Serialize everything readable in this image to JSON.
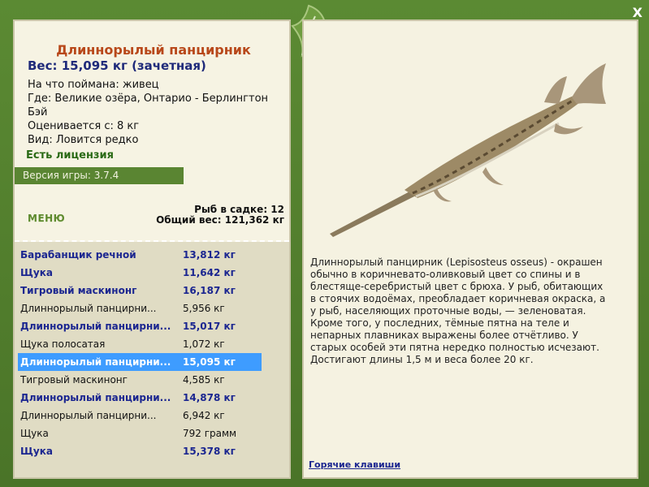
{
  "window": {
    "close_glyph": "X"
  },
  "fish": {
    "name": "Длиннорылый панцирник",
    "weight_line": "Вес: 15,095 кг (зачетная)",
    "bait": "На что поймана: живец",
    "location": "Где: Великие озёра, Онтарио - Берлингтон Бэй",
    "value": "Оценивается с: 8 кг",
    "rarity": "Вид: Ловится редко",
    "license": "Есть лицензия"
  },
  "game": {
    "version": "Версия игры: 3.7.4"
  },
  "menu": {
    "label": "МЕНЮ"
  },
  "keepnet": {
    "count_line": "Рыб в садке: 12",
    "total_line": "Общий вес: 121,362 кг"
  },
  "catch_list": [
    {
      "name": "Барабанщик речной",
      "weight": "13,812 кг",
      "bold": true,
      "selected": false
    },
    {
      "name": "Щука",
      "weight": "11,642 кг",
      "bold": true,
      "selected": false
    },
    {
      "name": "Тигровый маскинонг",
      "weight": "16,187 кг",
      "bold": true,
      "selected": false
    },
    {
      "name": "Длиннорылый панцирни...",
      "weight": "5,956 кг",
      "bold": false,
      "selected": false
    },
    {
      "name": "Длиннорылый панцирни...",
      "weight": "15,017 кг",
      "bold": true,
      "selected": false
    },
    {
      "name": "Щука полосатая",
      "weight": "1,072 кг",
      "bold": false,
      "selected": false
    },
    {
      "name": "Длиннорылый панцирни...",
      "weight": "15,095 кг",
      "bold": true,
      "selected": true
    },
    {
      "name": "Тигровый маскинонг",
      "weight": "4,585 кг",
      "bold": false,
      "selected": false
    },
    {
      "name": "Длиннорылый панцирни...",
      "weight": "14,878 кг",
      "bold": true,
      "selected": false
    },
    {
      "name": "Длиннорылый панцирни...",
      "weight": "6,942 кг",
      "bold": false,
      "selected": false
    },
    {
      "name": "Щука",
      "weight": "792 грамм",
      "bold": false,
      "selected": false
    },
    {
      "name": "Щука",
      "weight": "15,378 кг",
      "bold": true,
      "selected": false
    }
  ],
  "description": "Длиннорылый панцирник (Lepisosteus osseus) - окрашен обычно в коричневато-оливковый цвет со спины и в блестяще-серебристый цвет с брюха. У рыб, обитающих в стоячих водоёмах, преобладает коричневая окраска, а у рыб, населяющих проточные воды, — зеленоватая. Кроме того, у последних, тёмные пятна на теле и непарных плавниках выражены более отчётливо. У старых особей эти пятна нередко полностью исчезают. Достигают длины 1,5 м и веса более 20 кг.",
  "hotkeys": {
    "label": "Горячие клавиши"
  },
  "colors": {
    "frame": "#4f7a2c",
    "panel": "#f5f2e1",
    "selected": "#3e9cff",
    "bold_text": "#1b2690",
    "name_text": "#b8481a"
  },
  "icons": {
    "leaf": "leaf-logo-icon",
    "fish": "longnose-gar-illustration"
  }
}
